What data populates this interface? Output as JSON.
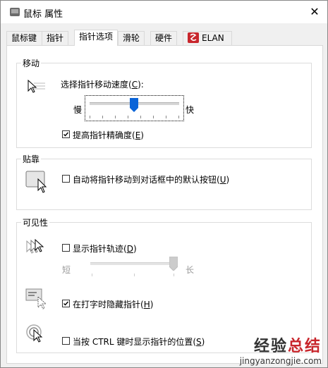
{
  "window": {
    "title": "鼠标 属性",
    "close_glyph": "✕"
  },
  "tabs": [
    {
      "label": "鼠标键"
    },
    {
      "label": "指针"
    },
    {
      "label": "指针选项"
    },
    {
      "label": "滑轮"
    },
    {
      "label": "硬件"
    },
    {
      "label": "ELAN"
    }
  ],
  "active_tab": "指针选项",
  "motion": {
    "title": "移动",
    "speed_label": "选择指针移动速度(",
    "speed_key": "C",
    "speed_tail": "):",
    "slow": "慢",
    "fast": "快",
    "speed_level": 0.5,
    "precision_label": "提高指针精确度(",
    "precision_key": "E",
    "precision_tail": ")",
    "precision_checked": true
  },
  "snap": {
    "title": "贴靠",
    "label": "自动将指针移动到对话框中的默认按钮(",
    "key": "U",
    "tail": ")",
    "checked": false
  },
  "visibility": {
    "title": "可见性",
    "trails_label": "显示指针轨迹(",
    "trails_key": "D",
    "trails_tail": ")",
    "trails_checked": false,
    "short": "短",
    "long": "长",
    "trails_level": 1.0,
    "hide_label": "在打字时隐藏指针(",
    "hide_key": "H",
    "hide_tail": ")",
    "hide_checked": true,
    "ctrl_label": "当按 CTRL 键时显示指针的位置(",
    "ctrl_key": "S",
    "ctrl_tail": ")",
    "ctrl_checked": false
  },
  "watermark": {
    "cn_black": "经验",
    "cn_red": "总结",
    "en": "jingyanzongjie.com"
  }
}
